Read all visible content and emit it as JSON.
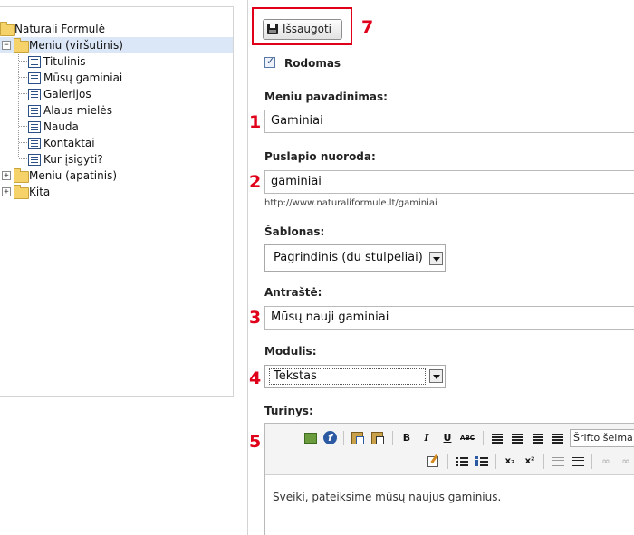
{
  "tree": {
    "root": "Naturali Formulė",
    "menu_top": "Meniu (viršutinis)",
    "children": [
      "Titulinis",
      "Mūsų gaminiai",
      "Galerijos",
      "Alaus mielės",
      "Nauda",
      "Kontaktai",
      "Kur įsigyti?"
    ],
    "menu_bottom": "Meniu (apatinis)",
    "other": "Kita",
    "expand": "+",
    "collapse": "−"
  },
  "form": {
    "save_label": "Išsaugoti",
    "visible_label": "Rodomas",
    "menu_name_label": "Meniu pavadinimas:",
    "menu_name_value": "Gaminiai",
    "page_link_label": "Puslapio nuoroda:",
    "page_link_value": "gaminiai",
    "page_link_hint": "http://www.naturaliformule.lt/gaminiai",
    "template_label": "Šablonas:",
    "template_value": "Pagrindinis (du stulpeliai)",
    "heading_label": "Antraštė:",
    "heading_value": "Mūsų nauji gaminiai",
    "module_label": "Modulis:",
    "module_value": "Tekstas",
    "content_label": "Turinys:",
    "font_family_label": "Šrifto šeima",
    "content_text": "Sveiki, pateiksime mūsų naujus gaminius."
  },
  "toolbar": {
    "bold": "B",
    "italic": "I",
    "underline": "U",
    "strike": "ABC",
    "subscript": "x₂",
    "superscript": "x²"
  },
  "annotations": [
    "1",
    "2",
    "3",
    "4",
    "5",
    "7"
  ],
  "colors": {
    "annotation": "#e0001a",
    "selection": "#dbe6f6",
    "border": "#b9b9b9"
  }
}
